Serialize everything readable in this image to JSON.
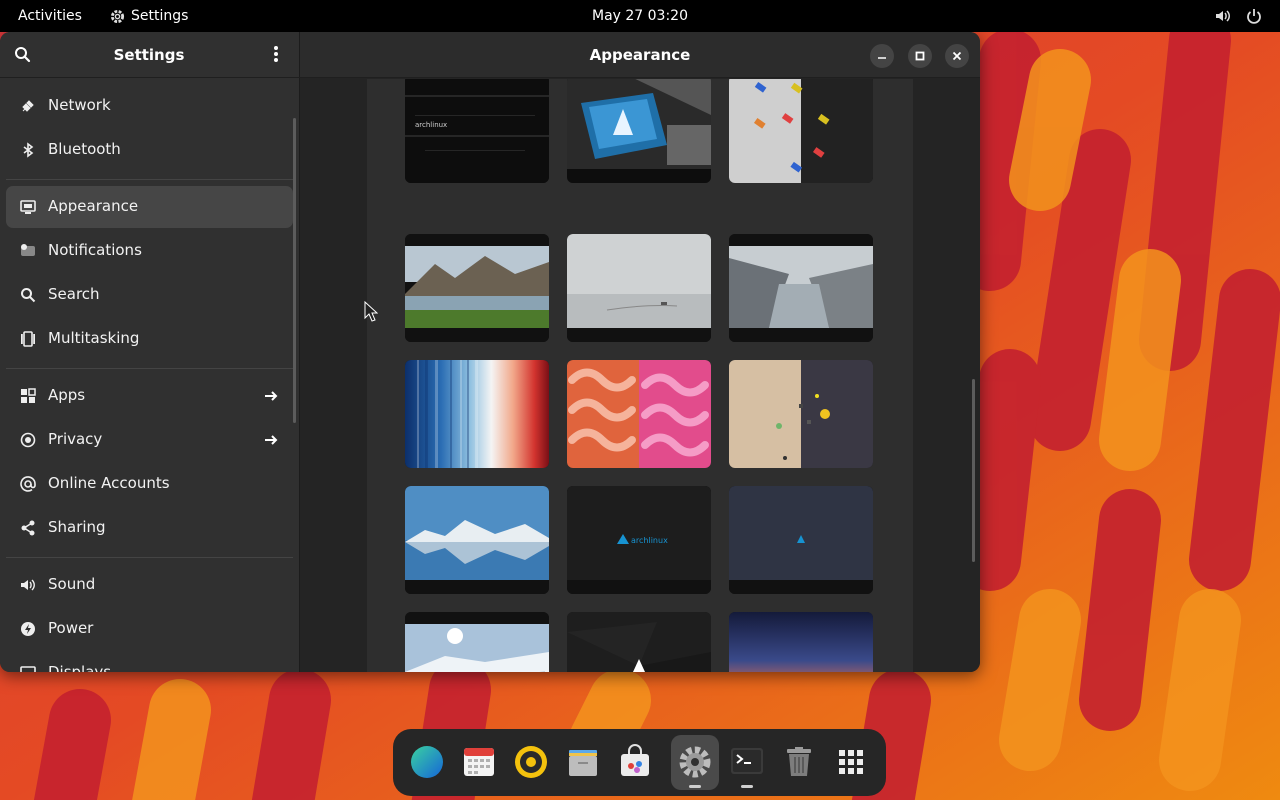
{
  "topbar": {
    "activities": "Activities",
    "app_name": "Settings",
    "clock": "May 27  03:20",
    "icons": [
      "gear-icon",
      "volume-icon",
      "power-icon"
    ]
  },
  "sidebar": {
    "title": "Settings",
    "items": [
      {
        "label": "Network",
        "icon": "network-icon"
      },
      {
        "label": "Bluetooth",
        "icon": "bluetooth-icon"
      },
      {
        "label": "Appearance",
        "icon": "appearance-icon",
        "active": true
      },
      {
        "label": "Notifications",
        "icon": "notifications-icon"
      },
      {
        "label": "Search",
        "icon": "search-icon"
      },
      {
        "label": "Multitasking",
        "icon": "multitasking-icon"
      },
      {
        "label": "Apps",
        "icon": "apps-icon",
        "has_arrow": true
      },
      {
        "label": "Privacy",
        "icon": "privacy-icon",
        "has_arrow": true
      },
      {
        "label": "Online Accounts",
        "icon": "online-accounts-icon"
      },
      {
        "label": "Sharing",
        "icon": "sharing-icon"
      },
      {
        "label": "Sound",
        "icon": "sound-icon"
      },
      {
        "label": "Power",
        "icon": "power-icon"
      },
      {
        "label": "Displays",
        "icon": "displays-icon"
      }
    ]
  },
  "content": {
    "title": "Appearance",
    "wallpapers": {
      "items": [
        {
          "name": "archlinux-dark-glitch"
        },
        {
          "name": "archlinux-retro-tv"
        },
        {
          "name": "colored-keys"
        },
        {
          "name": "mountain-lake"
        },
        {
          "name": "foggy-shore"
        },
        {
          "name": "fjord"
        },
        {
          "name": "warming-stripes"
        },
        {
          "name": "pink-orange-pattern"
        },
        {
          "name": "space-sand-split"
        },
        {
          "name": "snow-mountain-reflection"
        },
        {
          "name": "archlinux-logo-dark"
        },
        {
          "name": "arch-minimal-navy"
        },
        {
          "name": "snowfield-sun"
        },
        {
          "name": "arch-dark-facets"
        },
        {
          "name": "sunset-clouds"
        }
      ],
      "archlinux_text": "archlinux"
    }
  },
  "dock": {
    "apps": [
      "web-browser-icon",
      "calendar-icon",
      "rhythmbox-icon",
      "files-icon",
      "software-icon",
      "settings-icon",
      "terminal-icon",
      "trash-icon",
      "app-grid-icon"
    ],
    "active_app": "settings-icon"
  },
  "colors": {
    "wallpaper_orange": "#e8550f",
    "wallpaper_red": "#c7242e",
    "window_bg": "#242424",
    "sidebar_bg": "#303030",
    "active_item": "#464646"
  }
}
